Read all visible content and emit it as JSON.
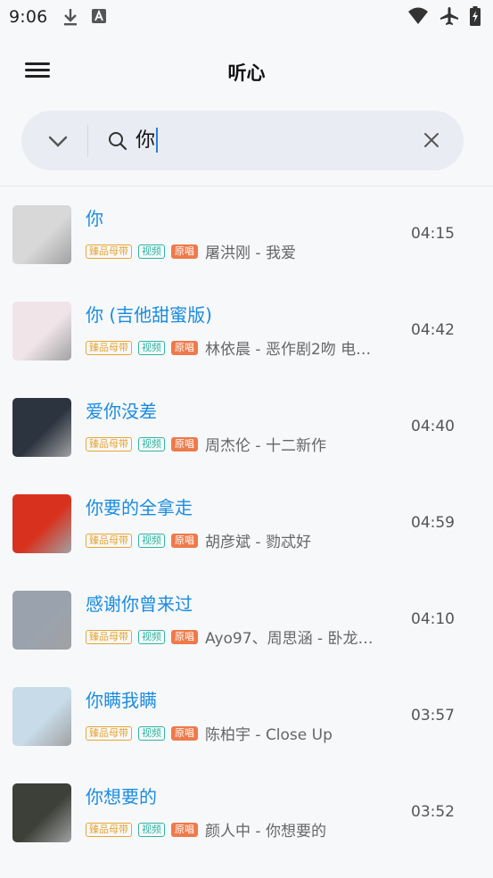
{
  "status": {
    "time": "9:06"
  },
  "app": {
    "title": "听心"
  },
  "search": {
    "query": "你"
  },
  "tags": {
    "master": "臻品母带",
    "video": "视频",
    "original": "原唱"
  },
  "songs": [
    {
      "title": "你",
      "artist": "屠洪刚 - 我爱",
      "duration": "04:15",
      "cover_color": "#d8d8d8"
    },
    {
      "title": "你 (吉他甜蜜版)",
      "artist": "林依晨 - 恶作剧2吻 电…",
      "duration": "04:42",
      "cover_color": "#f0e4e8"
    },
    {
      "title": "爱你没差",
      "artist": "周杰伦 - 十二新作",
      "duration": "04:40",
      "cover_color": "#2c3440"
    },
    {
      "title": "你要的全拿走",
      "artist": "胡彦斌 - 勠忒好",
      "duration": "04:59",
      "cover_color": "#d8321e"
    },
    {
      "title": "感谢你曾来过",
      "artist": "Ayo97、周思涵 - 卧龙…",
      "duration": "04:10",
      "cover_color": "#9aa3ad"
    },
    {
      "title": "你瞒我瞒",
      "artist": "陈柏宇 - Close Up",
      "duration": "03:57",
      "cover_color": "#c7dbe8"
    },
    {
      "title": "你想要的",
      "artist": "颜人中 - 你想要的",
      "duration": "03:52",
      "cover_color": "#3c4038"
    }
  ]
}
